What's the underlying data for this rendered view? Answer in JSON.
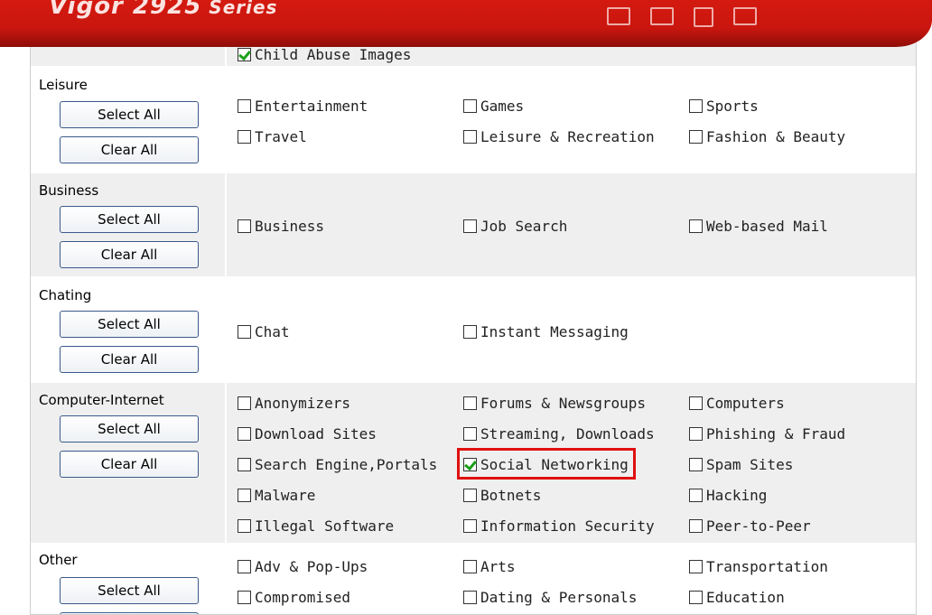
{
  "banner": {
    "title": "Vigor 2925",
    "series": "Series"
  },
  "top_partial_item": {
    "label": "Child Abuse Images",
    "checked": true
  },
  "buttons": {
    "select_all": "Select All",
    "clear_all": "Clear All"
  },
  "categories": [
    {
      "name": "Leisure",
      "items": [
        {
          "label": "Entertainment",
          "checked": false
        },
        {
          "label": "Games",
          "checked": false
        },
        {
          "label": "Sports",
          "checked": false
        },
        {
          "label": "Travel",
          "checked": false
        },
        {
          "label": "Leisure & Recreation",
          "checked": false
        },
        {
          "label": "Fashion & Beauty",
          "checked": false
        }
      ]
    },
    {
      "name": "Business",
      "items": [
        {
          "label": "Business",
          "checked": false
        },
        {
          "label": "Job Search",
          "checked": false
        },
        {
          "label": "Web-based Mail",
          "checked": false
        }
      ]
    },
    {
      "name": "Chating",
      "items": [
        {
          "label": "Chat",
          "checked": false
        },
        {
          "label": "Instant Messaging",
          "checked": false
        }
      ]
    },
    {
      "name": "Computer-Internet",
      "items": [
        {
          "label": "Anonymizers",
          "checked": false
        },
        {
          "label": "Forums & Newsgroups",
          "checked": false
        },
        {
          "label": "Computers",
          "checked": false
        },
        {
          "label": "Download Sites",
          "checked": false
        },
        {
          "label": "Streaming, Downloads",
          "checked": false
        },
        {
          "label": "Phishing & Fraud",
          "checked": false
        },
        {
          "label": "Search Engine,Portals",
          "checked": false
        },
        {
          "label": "Social Networking",
          "checked": true
        },
        {
          "label": "Spam Sites",
          "checked": false
        },
        {
          "label": "Malware",
          "checked": false
        },
        {
          "label": "Botnets",
          "checked": false
        },
        {
          "label": "Hacking",
          "checked": false
        },
        {
          "label": "Illegal Software",
          "checked": false
        },
        {
          "label": "Information Security",
          "checked": false
        },
        {
          "label": "Peer-to-Peer",
          "checked": false
        }
      ]
    },
    {
      "name": "Other",
      "items": [
        {
          "label": "Adv & Pop-Ups",
          "checked": false
        },
        {
          "label": "Arts",
          "checked": false
        },
        {
          "label": "Transportation",
          "checked": false
        },
        {
          "label": "Compromised",
          "checked": false
        },
        {
          "label": "Dating & Personals",
          "checked": false
        },
        {
          "label": "Education",
          "checked": false
        }
      ]
    }
  ],
  "highlight_color": "#e01010",
  "accent_color": "#c9160e"
}
